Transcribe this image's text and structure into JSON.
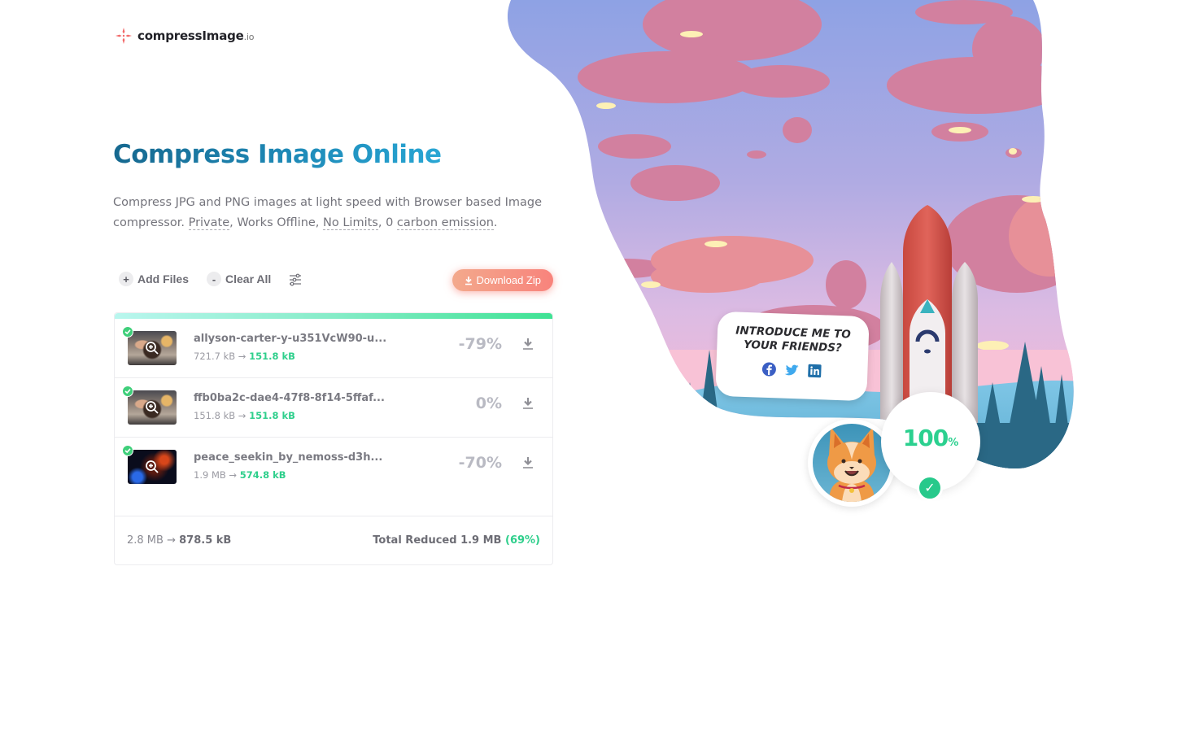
{
  "logo": {
    "name": "compressImage",
    "tld": ".io"
  },
  "hero": {
    "title": "Compress Image Online",
    "desc_prefix": "Compress JPG and PNG images at light speed with Browser based Image compressor. ",
    "feature_private": "Private",
    "sep1": ", Works Offline, ",
    "feature_nolimits": "No Limits",
    "sep2": ", 0 ",
    "feature_carbon": "carbon emission",
    "desc_suffix": "."
  },
  "toolbar": {
    "add_icon": "+",
    "add_label": "Add Files",
    "clear_icon": "-",
    "clear_label": "Clear All",
    "settings_icon": "sliders-icon",
    "download_zip_label": "Download Zip"
  },
  "progress": {
    "percent": 100
  },
  "files": [
    {
      "name": "allyson-carter-y-u351VcW90-u...",
      "original_size": "721.7 kB",
      "compressed_size": "151.8 kB",
      "reduction": "-79%",
      "status": "done",
      "thumb": "photo"
    },
    {
      "name": "ffb0ba2c-dae4-47f8-8f14-5ffaf...",
      "original_size": "151.8 kB",
      "compressed_size": "151.8 kB",
      "reduction": "0%",
      "status": "done",
      "thumb": "photo"
    },
    {
      "name": "peace_seekin_by_nemoss-d3h...",
      "original_size": "1.9 MB",
      "compressed_size": "574.8 kB",
      "reduction": "-70%",
      "status": "done",
      "thumb": "space"
    }
  ],
  "arrow": "→",
  "summary": {
    "original_total": "2.8 MB",
    "compressed_total": "878.5 kB",
    "reduced_label": "Total Reduced",
    "reduced_amount": "1.9 MB",
    "reduced_percent": "(69%)"
  },
  "illustration": {
    "bubble_line1": "Introduce me to",
    "bubble_line2": "your friends?",
    "social": [
      "facebook",
      "twitter",
      "linkedin"
    ],
    "progress_value": "100",
    "progress_unit": "%",
    "check": "✓"
  },
  "colors": {
    "accent_green": "#2fcf8c",
    "title_blue": "#1f8dbb",
    "download_zip": "#f8837c"
  }
}
